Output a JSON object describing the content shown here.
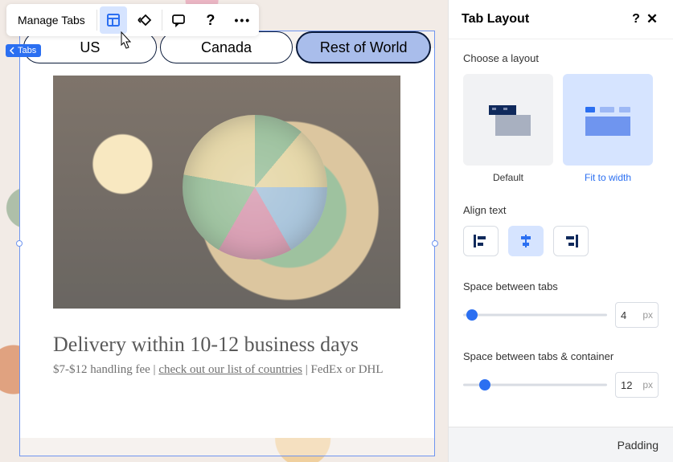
{
  "toolbar": {
    "manage_label": "Manage Tabs",
    "icons": {
      "layout": "layout-icon",
      "animate": "animate-icon",
      "comment": "comment-icon",
      "help": "help-icon",
      "more": "more-icon"
    }
  },
  "crumb": {
    "label": "Tabs"
  },
  "tabs": {
    "items": [
      {
        "label": "US",
        "selected": false
      },
      {
        "label": "Canada",
        "selected": false
      },
      {
        "label": "Rest of World",
        "selected": true
      }
    ]
  },
  "content": {
    "heading": "Delivery within 10-12 business days",
    "sub_prefix": "$7-$12 handling fee | ",
    "sub_link": "check out our list of countries",
    "sub_suffix": " | FedEx or DHL"
  },
  "panel": {
    "title": "Tab Layout",
    "choose_label": "Choose a layout",
    "layout_opts": [
      {
        "caption": "Default",
        "selected": false
      },
      {
        "caption": "Fit to width",
        "selected": true
      }
    ],
    "align_label": "Align text",
    "align_selected": "center",
    "space_tabs": {
      "label": "Space between tabs",
      "value": "4",
      "unit": "px",
      "pct": 6
    },
    "space_container": {
      "label": "Space between tabs & container",
      "value": "12",
      "unit": "px",
      "pct": 15
    },
    "footer_label": "Padding"
  },
  "colors": {
    "accent": "#2b6ff1"
  }
}
